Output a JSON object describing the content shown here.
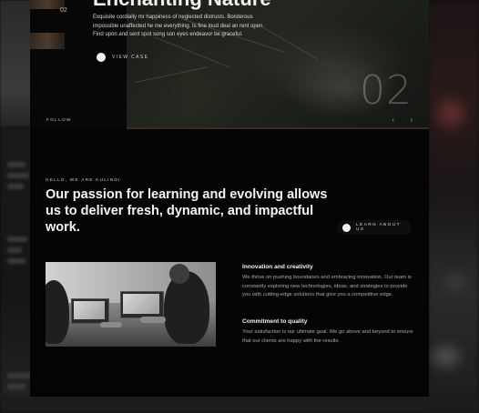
{
  "hero": {
    "title": "Enchanting Nature",
    "description": "Exquisite cordially mr happiness of neglected distrusts. Boisterous impossible unaffected he me everything. Is fine loud deal an rent open. Find upon and sent spot song son eyes endeavor be graceful.",
    "view_case_label": "VIEW CASE",
    "thumbnail_number": "02",
    "slide_number": "02",
    "follow_label": "FOLLOW",
    "prev_arrow": "‹",
    "next_arrow": "›"
  },
  "about": {
    "eyebrow": "HELLO, WE ARE KULINDI",
    "heading": "Our passion for learning and evolving allows us to deliver fresh, dynamic, and impactful work.",
    "learn_button_label": "LEARN ABOUT US"
  },
  "features": [
    {
      "title": "Innovation and creativity",
      "text": "We thrive on pushing boundaries and embracing innovation. Our team is constantly exploring new technologies, ideas, and strategies to provide you with cutting-edge solutions that give you a competitive edge."
    },
    {
      "title": "Commitment to quality",
      "text": "Your satisfaction is our ultimate goal. We go above and beyond to ensure that our clients are happy with the results."
    }
  ],
  "colors": {
    "background": "#040405",
    "text_primary": "#f5f5f5",
    "text_muted": "#a9a9a9",
    "accent_dot": "#f4f4f4"
  }
}
